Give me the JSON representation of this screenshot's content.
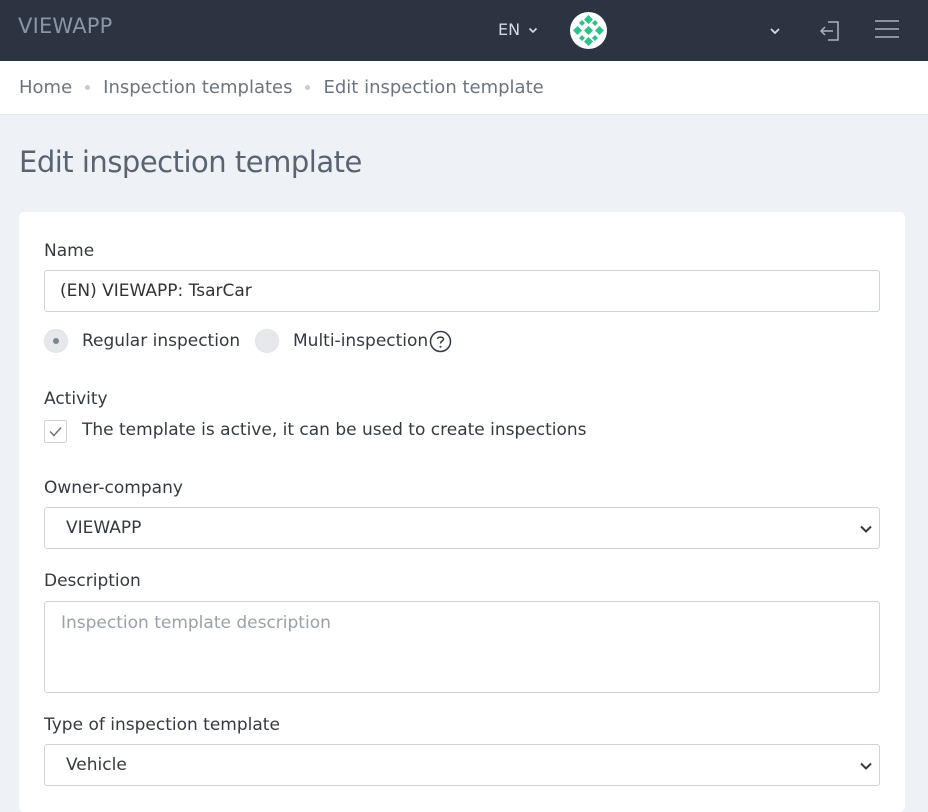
{
  "header": {
    "brand": "VIEWAPP",
    "language": "EN",
    "icons": [
      "chevron-down-icon",
      "avatar",
      "logout-icon",
      "hamburger-menu-icon"
    ]
  },
  "breadcrumb": {
    "items": [
      "Home",
      "Inspection templates",
      "Edit inspection template"
    ]
  },
  "page": {
    "title": "Edit inspection template"
  },
  "form": {
    "name_label": "Name",
    "name_value": "(EN) VIEWAPP: TsarCar",
    "inspection_type": {
      "options": [
        "Regular inspection",
        "Multi-inspection"
      ],
      "selected": "Regular inspection"
    },
    "activity_label": "Activity",
    "activity_checkbox_label": "The template is active, it can be used to create inspections",
    "activity_checked": true,
    "owner_label": "Owner-company",
    "owner_value": "VIEWAPP",
    "description_label": "Description",
    "description_placeholder": "Inspection template description",
    "description_value": "",
    "template_type_label": "Type of inspection template",
    "template_type_value": "Vehicle"
  },
  "colors": {
    "topbar": "#2b3440",
    "background": "#eef1f6",
    "avatar_accent": "#2ec28a"
  }
}
